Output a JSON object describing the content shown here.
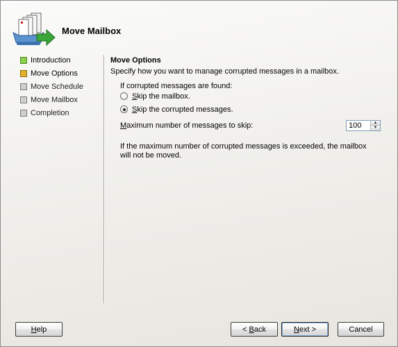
{
  "header": {
    "title": "Move Mailbox"
  },
  "nav": {
    "items": [
      {
        "label": "Introduction",
        "state": "done"
      },
      {
        "label": "Move Options",
        "state": "current"
      },
      {
        "label": "Move Schedule",
        "state": "pending"
      },
      {
        "label": "Move Mailbox",
        "state": "pending"
      },
      {
        "label": "Completion",
        "state": "pending"
      }
    ]
  },
  "content": {
    "section_title": "Move Options",
    "section_desc": "Specify how you want to manage corrupted messages in a mailbox.",
    "group_label": "If corrupted messages are found:",
    "options": [
      {
        "label_key": "S",
        "label_rest": "kip the mailbox.",
        "checked": false
      },
      {
        "label_key": "S",
        "label_rest": "kip the corrupted messages.",
        "checked": true
      }
    ],
    "max_label_key": "M",
    "max_label_rest": "aximum number of messages to skip:",
    "max_value": "100",
    "note": "If the maximum number of corrupted messages is exceeded, the mailbox will not be moved."
  },
  "buttons": {
    "help_key": "H",
    "help_rest": "elp",
    "back_prefix": "< ",
    "back_key": "B",
    "back_rest": "ack",
    "next_key": "N",
    "next_rest": "ext >",
    "cancel": "Cancel"
  },
  "colors": {
    "nav_done": "#8ccf4a",
    "nav_current": "#e3b12a",
    "nav_pending": "#cfcfcf"
  }
}
